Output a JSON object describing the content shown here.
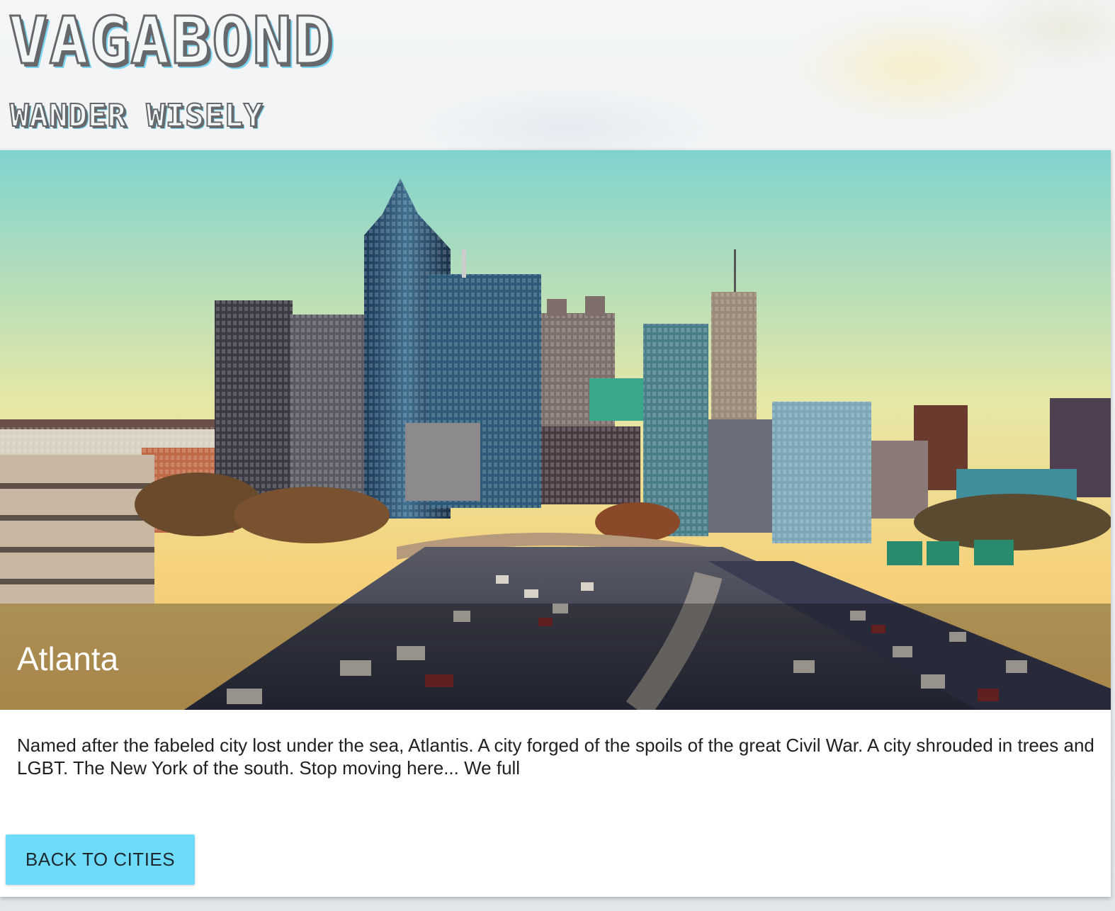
{
  "header": {
    "logo_text": "VAGABOND",
    "tagline": "WANDER WISELY"
  },
  "city": {
    "name": "Atlanta",
    "description": "Named after the fabeled city lost under the sea, Atlantis. A city forged of the spoils of the great Civil War. A city shrouded in trees and LGBT. The New York of the south. Stop moving here... We full"
  },
  "actions": {
    "back_label": "BACK TO CITIES"
  },
  "colors": {
    "accent": "#6fdbfb",
    "logo_outline": "#67686b",
    "logo_shadow": "#7ad6f2"
  }
}
